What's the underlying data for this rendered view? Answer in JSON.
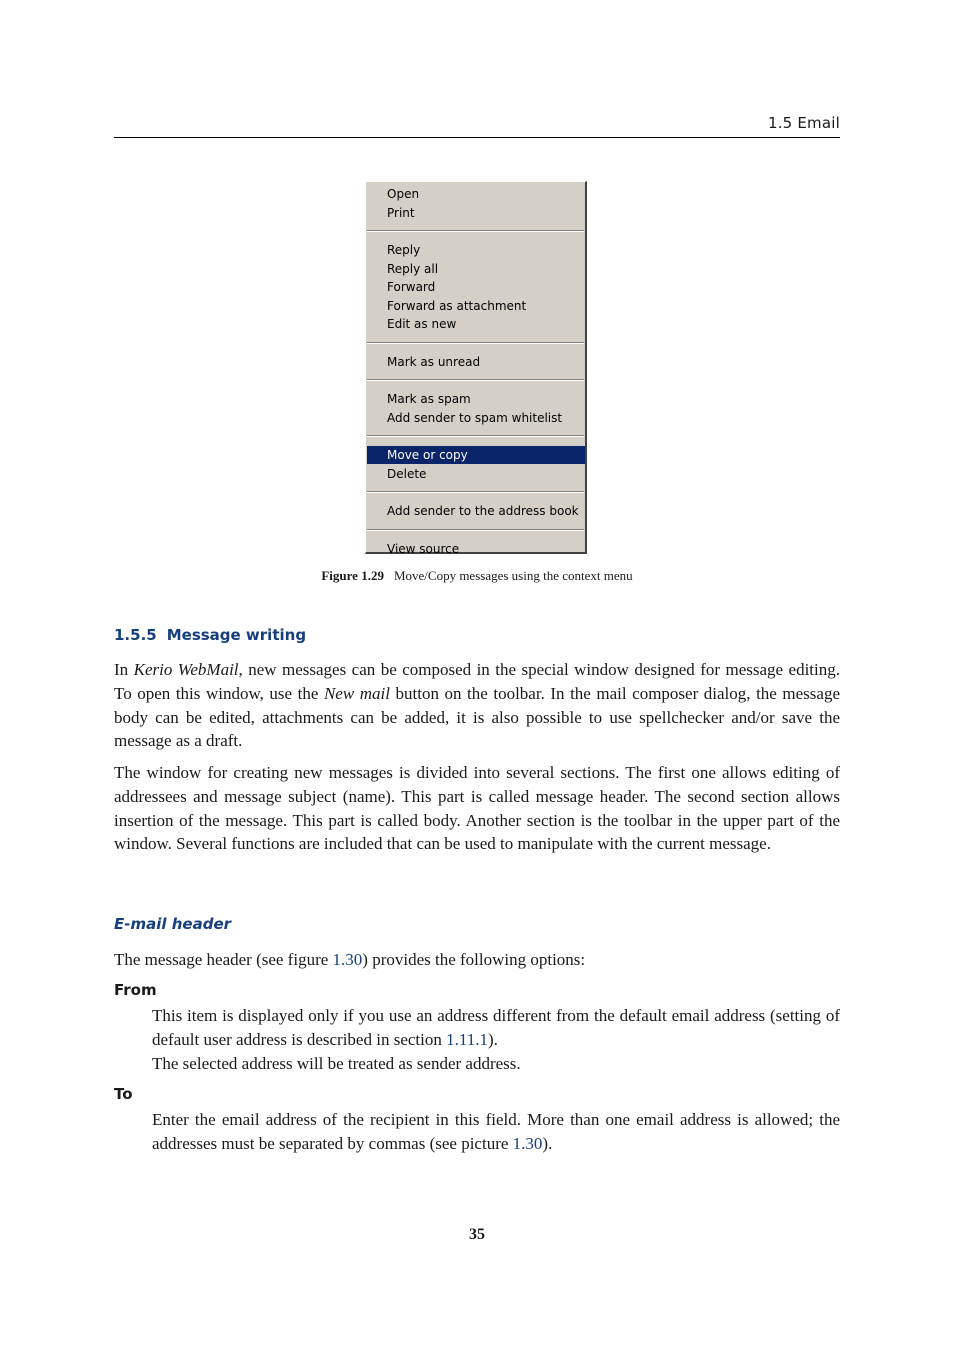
{
  "running_head": "1.5  Email",
  "context_menu": {
    "groups": [
      [
        "Open",
        "Print"
      ],
      [
        "Reply",
        "Reply all",
        "Forward",
        "Forward as attachment",
        "Edit as new"
      ],
      [
        "Mark as unread"
      ],
      [
        "Mark as spam",
        "Add sender to spam whitelist"
      ],
      [
        "Move or copy",
        "Delete"
      ],
      [
        "Add sender to the address book"
      ],
      [
        "View source"
      ]
    ],
    "highlighted_item": "Move or copy",
    "highlight_color": "#0a246a",
    "background_color": "#d4d0c8"
  },
  "figure_caption": {
    "label": "Figure 1.29",
    "text": "Move/Copy messages using the context menu"
  },
  "section": {
    "number": "1.5.5",
    "title": "Message writing"
  },
  "paragraphs": {
    "p1": {
      "a": "In ",
      "app_name": "Kerio WebMail",
      "b": ", new messages can be composed in the special window designed for message editing. To open this window, use the ",
      "button_name": "New mail",
      "c": " button on the toolbar. In the mail composer dialog, the message body can be edited, attachments can be added, it is also possible to use spellchecker and/or save the message as a draft."
    },
    "p2": "The window for creating new messages is divided into several sections. The first one allows editing of addressees and message subject (name). This part is called message header. The second section allows insertion of the message. This part is called body. Another section is the toolbar in the upper part of the window. Several functions are included that can be used to manipulate with the current message.",
    "subheading": "E-mail header",
    "p3": {
      "a": "The message header (see figure ",
      "ref": "1.30",
      "b": ") provides the following options:"
    }
  },
  "definitions": {
    "from": {
      "term": "From",
      "line1": "This item is displayed only if you use an address different from the default email address (setting of default user address is described in section ",
      "ref": "1.11.1",
      "line1_end": ").",
      "line2": "The selected address will be treated as sender address."
    },
    "to": {
      "term": "To",
      "text": "Enter the email address of the recipient in this field.  More than one email address is allowed; the addresses must be separated by commas (see picture ",
      "ref": "1.30",
      "end": ")."
    }
  },
  "page_number": "35",
  "colors": {
    "heading_blue": "#173e7e"
  }
}
